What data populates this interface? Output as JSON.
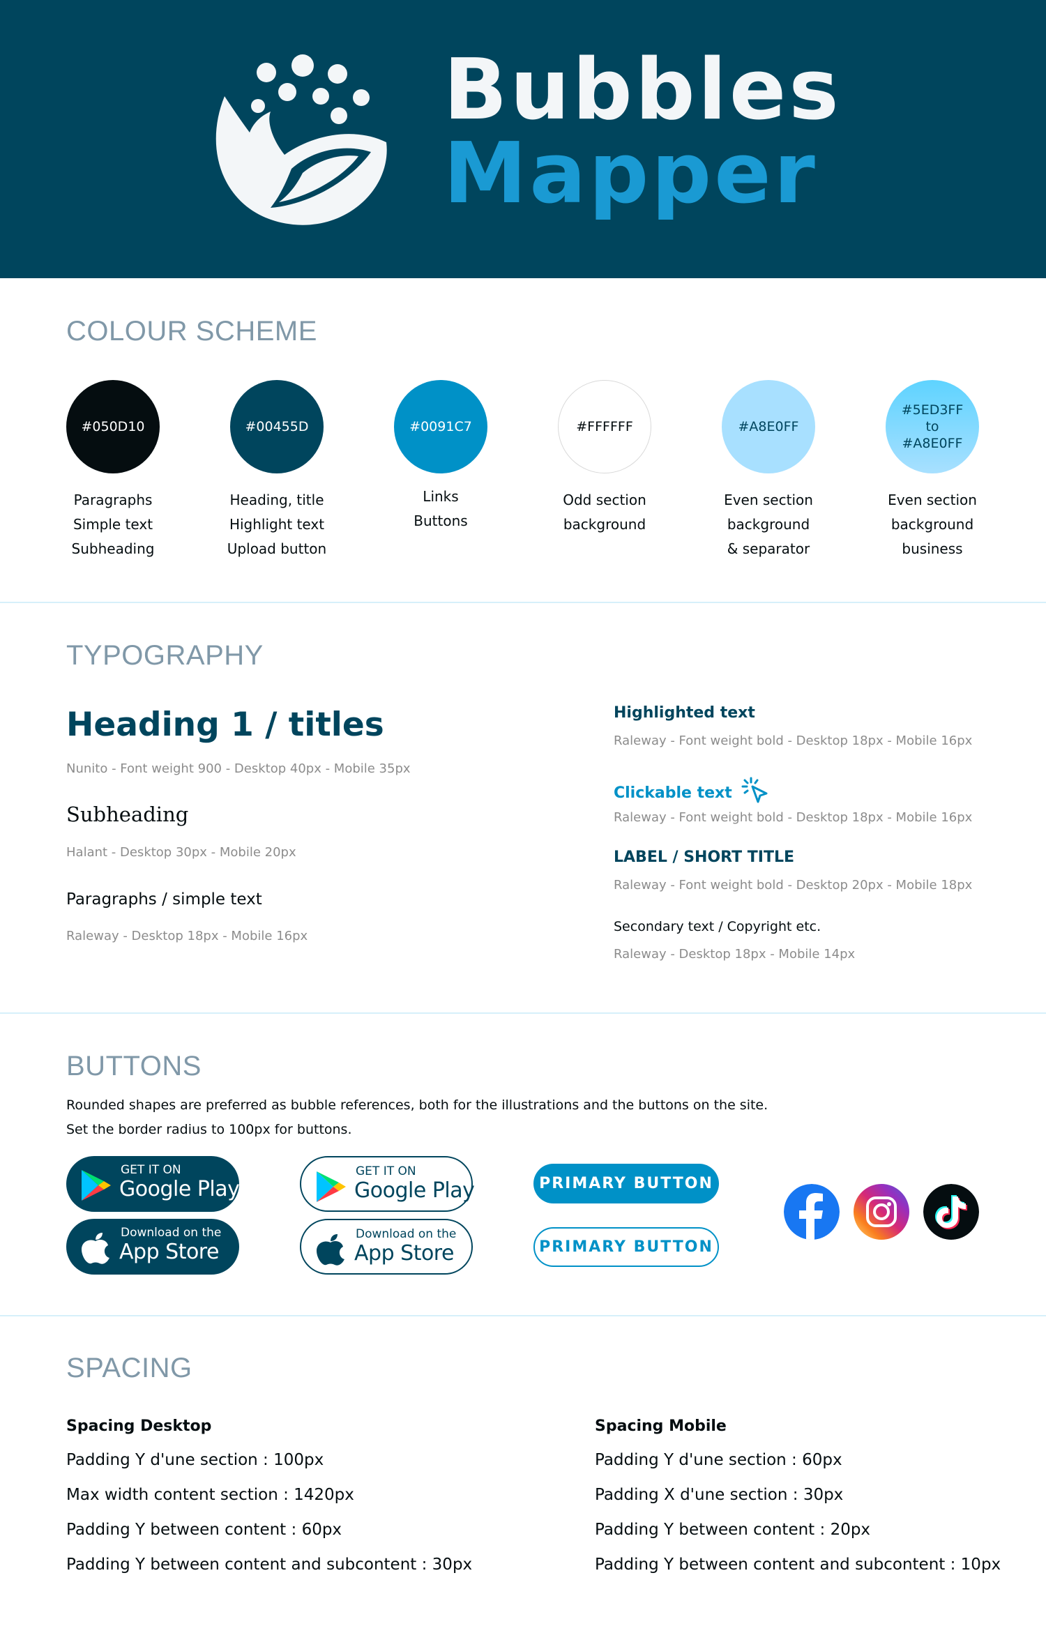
{
  "brand": {
    "line1": "Bubbles",
    "line2": "Mapper"
  },
  "colours": {
    "title": "COLOUR SCHEME",
    "swatches": [
      {
        "hex": "#050D10",
        "label": "#050D10",
        "uses": [
          "Paragraphs",
          "Simple text",
          "Subheading"
        ]
      },
      {
        "hex": "#00455D",
        "label": "#00455D",
        "uses": [
          "Heading, title",
          "Highlight text",
          "Upload button"
        ]
      },
      {
        "hex": "#0091C7",
        "label": "#0091C7",
        "uses": [
          "Links",
          "Buttons"
        ]
      },
      {
        "hex": "#FFFFFF",
        "label": "#FFFFFF",
        "uses": [
          "Odd section",
          "background"
        ]
      },
      {
        "hex": "#A8E0FF",
        "label": "#A8E0FF",
        "uses": [
          "Even section",
          "background",
          "& separator"
        ]
      },
      {
        "hex": "#5ED3FF",
        "label_lines": [
          "#5ED3FF",
          "to",
          "#A8E0FF"
        ],
        "uses": [
          "Even section",
          "background",
          "business"
        ]
      }
    ]
  },
  "typography": {
    "title": "TYPOGRAPHY",
    "heading1": "Heading 1 / titles",
    "heading1_meta": "Nunito - Font weight 900 - Desktop 40px - Mobile 35px",
    "subheading": "Subheading",
    "subheading_meta": "Halant - Desktop 30px - Mobile 20px",
    "paragraph": "Paragraphs / simple text",
    "paragraph_meta": "Raleway - Desktop 18px - Mobile 16px",
    "highlighted": "Highlighted text",
    "highlighted_meta": "Raleway - Font weight bold - Desktop 18px - Mobile 16px",
    "clickable": "Clickable text",
    "clickable_meta": "Raleway - Font weight bold - Desktop 18px - Mobile 16px",
    "label": "LABEL / SHORT TITLE",
    "label_meta": "Raleway - Font weight bold - Desktop 20px - Mobile 18px",
    "secondary": "Secondary text / Copyright etc.",
    "secondary_meta": "Raleway - Desktop 18px - Mobile 14px"
  },
  "buttons": {
    "title": "BUTTONS",
    "desc1": "Rounded shapes are preferred as bubble references, both for the illustrations and the buttons on the site.",
    "desc2": "Set the border radius to 100px for buttons.",
    "google_small": "GET IT ON",
    "google_big": "Google Play",
    "apple_small": "Download on the",
    "apple_big": "App Store",
    "primary_label": "PRIMARY BUTTON",
    "primary_outline_label": "PRIMARY BUTTON"
  },
  "spacing": {
    "title": "SPACING",
    "desktop": {
      "heading": "Spacing Desktop",
      "items": [
        "Padding Y d'une section : 100px",
        "Max width content section : 1420px",
        "Padding Y between content : 60px",
        "Padding Y between content and subcontent : 30px"
      ]
    },
    "mobile": {
      "heading": "Spacing Mobile",
      "items": [
        "Padding Y d'une section : 60px",
        "Padding X d'une section : 30px",
        "Padding Y between content : 20px",
        "Padding Y between content and subcontent : 10px"
      ]
    }
  }
}
